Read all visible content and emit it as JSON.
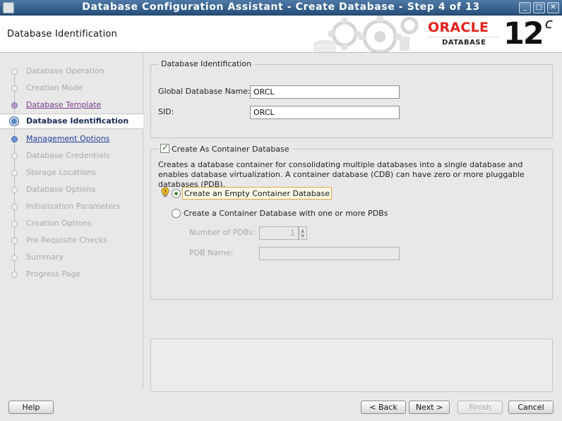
{
  "window": {
    "title": "Database Configuration Assistant - Create Database - Step 4 of 13",
    "controls": {
      "minimize": "_",
      "maximize": "□",
      "close": "✕"
    }
  },
  "header": {
    "page_title": "Database Identification",
    "logo_word": "ORACLE",
    "logo_sub": "DATABASE",
    "version": "12",
    "version_sup": "c",
    "colors": {
      "oracle_red": "#e32219"
    }
  },
  "nav": {
    "items": [
      {
        "label": "Database Operation",
        "state": "disabled"
      },
      {
        "label": "Creation Mode",
        "state": "disabled"
      },
      {
        "label": "Database Template",
        "state": "visited"
      },
      {
        "label": "Database Identification",
        "state": "current"
      },
      {
        "label": "Management Options",
        "state": "next"
      },
      {
        "label": "Database Credentials",
        "state": "disabled"
      },
      {
        "label": "Storage Locations",
        "state": "disabled"
      },
      {
        "label": "Database Options",
        "state": "disabled"
      },
      {
        "label": "Initialization Parameters",
        "state": "disabled"
      },
      {
        "label": "Creation Options",
        "state": "disabled"
      },
      {
        "label": "Pre Requisite Checks",
        "state": "disabled"
      },
      {
        "label": "Summary",
        "state": "disabled"
      },
      {
        "label": "Progress Page",
        "state": "disabled"
      }
    ]
  },
  "identification": {
    "legend": "Database Identification",
    "global_name_label": "Global Database Name:",
    "global_name_value": "ORCL",
    "sid_label": "SID:",
    "sid_value": "ORCL"
  },
  "container": {
    "checkbox_label": "Create As Container Database",
    "checked": true,
    "description": "Creates a database container for consolidating multiple databases into a single database and enables database virtualization. A container database (CDB) can have zero or more pluggable databases (PDB).",
    "option_empty": "Create an Empty Container Database",
    "option_with_pdbs": "Create a Container Database with one or more PDBs",
    "selected_option": "empty",
    "num_pdbs_label": "Number of PDBs:",
    "num_pdbs_value": "1",
    "pdb_name_label": "PDB Name:",
    "pdb_name_value": ""
  },
  "footer": {
    "help": "Help",
    "back": "< Back",
    "next": "Next >",
    "finish": "Finish",
    "cancel": "Cancel"
  }
}
